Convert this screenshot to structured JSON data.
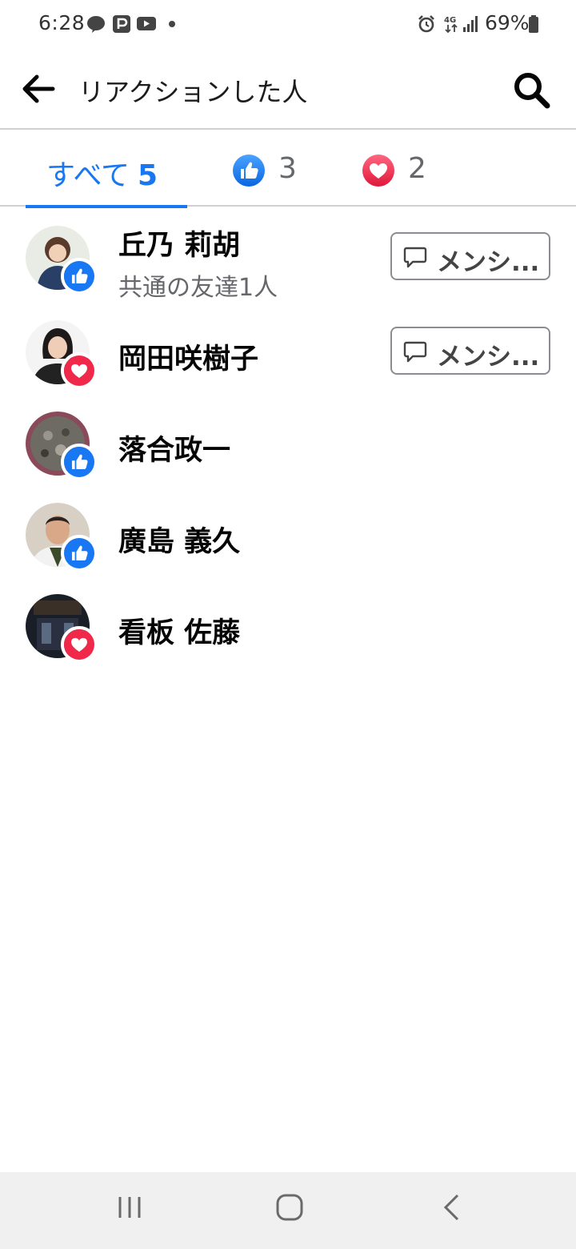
{
  "status_bar": {
    "time": "6:28",
    "network": "4G",
    "battery": "69%"
  },
  "header": {
    "title": "リアクションした人"
  },
  "tabs": [
    {
      "label": "すべて",
      "count": "5"
    },
    {
      "reaction": "like",
      "count": "3"
    },
    {
      "reaction": "love",
      "count": "2"
    }
  ],
  "people": [
    {
      "name": "丘乃 莉胡",
      "subtext": "共通の友達1人",
      "reaction": "like",
      "message_label": "メンシ..."
    },
    {
      "name": "岡田咲樹子",
      "reaction": "love",
      "message_label": "メンシ..."
    },
    {
      "name": "落合政一",
      "reaction": "like"
    },
    {
      "name": "廣島 義久",
      "reaction": "like"
    },
    {
      "name": "看板 佐藤",
      "reaction": "love"
    }
  ],
  "colors": {
    "accent": "#1877f2",
    "like": "#1877f2",
    "love": "#f0284a",
    "secondary_text": "#65676b"
  }
}
